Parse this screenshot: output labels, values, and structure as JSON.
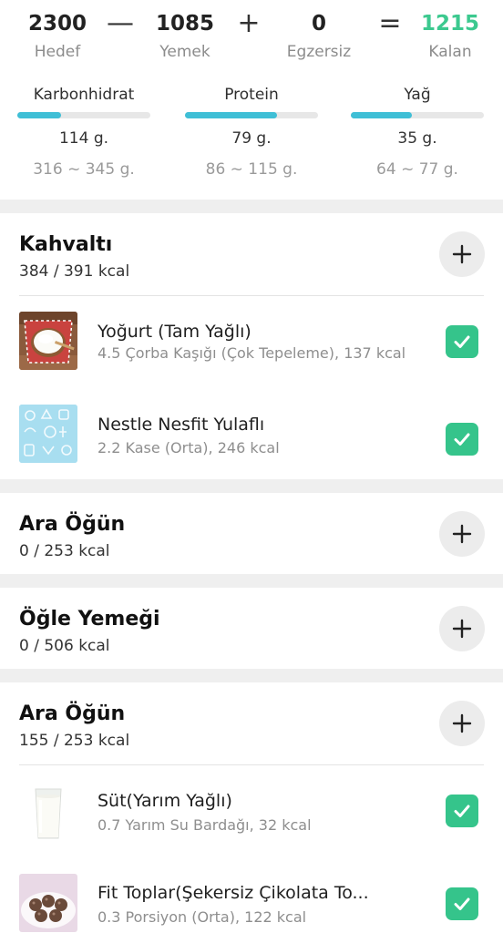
{
  "summary": {
    "goal": {
      "value": "2300",
      "label": "Hedef"
    },
    "minus": "—",
    "food": {
      "value": "1085",
      "label": "Yemek"
    },
    "plus": "+",
    "exercise": {
      "value": "0",
      "label": "Egzersiz"
    },
    "equals": "=",
    "remaining": {
      "value": "1215",
      "label": "Kalan",
      "color": "#3cc98f"
    }
  },
  "macros": [
    {
      "name": "Karbonhidrat",
      "amount": "114 g.",
      "range": "316 ~ 345 g.",
      "progress": 0.33
    },
    {
      "name": "Protein",
      "amount": "79 g.",
      "range": "86 ~ 115 g.",
      "progress": 0.69
    },
    {
      "name": "Yağ",
      "amount": "35 g.",
      "range": "64 ~ 77 g.",
      "progress": 0.46
    }
  ],
  "colors": {
    "accent": "#3fbfd6",
    "check": "#35c48b"
  },
  "meals": [
    {
      "title": "Kahvaltı",
      "kcal": "384 / 391 kcal",
      "items": [
        {
          "name": "Yoğurt (Tam Yağlı)",
          "desc": "4.5 Çorba Kaşığı (Çok Tepeleme), 137 kcal",
          "icon": "yogurt-photo"
        },
        {
          "name": "Nestle Nesfit Yulaflı",
          "desc": "2.2 Kase (Orta), 246 kcal",
          "icon": "placeholder-food-pattern"
        }
      ]
    },
    {
      "title": "Ara Öğün",
      "kcal": "0 / 253 kcal",
      "items": []
    },
    {
      "title": "Öğle Yemeği",
      "kcal": "0 / 506 kcal",
      "items": []
    },
    {
      "title": "Ara Öğün",
      "kcal": "155 / 253 kcal",
      "items": [
        {
          "name": "Süt(Yarım Yağlı)",
          "desc": "0.7 Yarım Su Bardağı, 32 kcal",
          "icon": "milk-glass-photo"
        },
        {
          "name": "Fit Toplar(Şekersiz Çikolata To...",
          "desc": "0.3 Porsiyon (Orta), 122 kcal",
          "icon": "chocolate-balls-photo"
        }
      ]
    }
  ]
}
